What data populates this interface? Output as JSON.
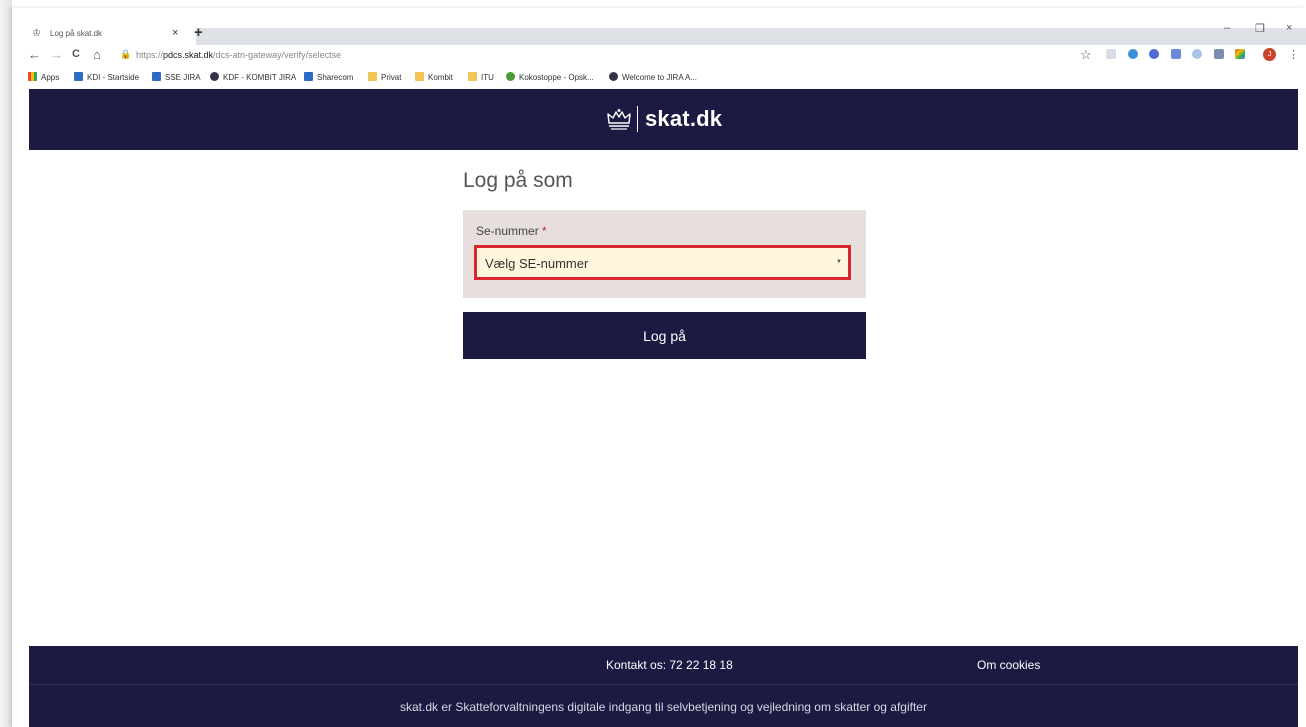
{
  "browser": {
    "tab_title": "Log på skat.dk",
    "tab_close": "×",
    "new_tab": "+",
    "back": "←",
    "forward": "→",
    "reload": "C",
    "home": "⌂",
    "url_prefix": "https://",
    "url_host": "pdcs.skat.dk",
    "url_path": "/dcs-atn-gateway/verify/selectse",
    "star": "☆",
    "avatar_initial": "J",
    "menu": "⋮",
    "minimize": "–",
    "restore": "❐",
    "close": "×"
  },
  "bookmarks": [
    {
      "label": "Apps",
      "icon": "apps-grid-icon"
    },
    {
      "label": "KDI - Startside",
      "icon": "sharepoint-icon"
    },
    {
      "label": "SSE JIRA",
      "icon": "jira-icon"
    },
    {
      "label": "KDF - KOMBIT JIRA",
      "icon": "jira-icon"
    },
    {
      "label": "Sharecom",
      "icon": "sharepoint-icon"
    },
    {
      "label": "Privat",
      "icon": "folder-icon"
    },
    {
      "label": "Kombit",
      "icon": "folder-icon"
    },
    {
      "label": "ITU",
      "icon": "folder-icon"
    },
    {
      "label": "Kokostoppe - Opsk...",
      "icon": "site-icon"
    },
    {
      "label": "Welcome to JIRA A...",
      "icon": "jira-icon"
    }
  ],
  "header": {
    "logo_text": "skat.dk"
  },
  "main": {
    "heading": "Log på som",
    "field_label": "Se-nummer",
    "required_mark": "*",
    "select_value": "Vælg SE-nummer",
    "submit_label": "Log på"
  },
  "footer": {
    "contact": "Kontakt os: 72 22 18 18",
    "cookies": "Om cookies",
    "tagline": "skat.dk er Skatteforvaltningens digitale indgang til selvbetjening og vejledning om skatter og afgifter"
  },
  "colors": {
    "brand_navy": "#1b1a42",
    "panel_bg": "#e7dfdd",
    "highlight_red": "#d9252c",
    "select_bg": "#fdf6dc"
  }
}
